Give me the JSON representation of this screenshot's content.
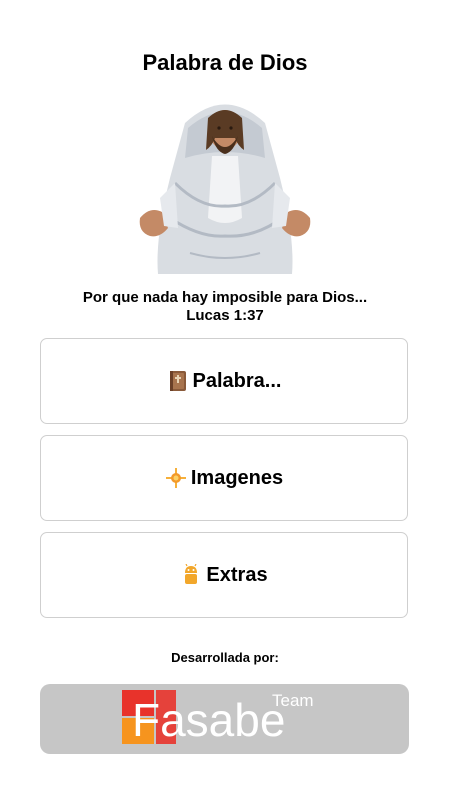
{
  "app": {
    "title": "Palabra de Dios"
  },
  "hero": {
    "image": "jesus-figure"
  },
  "verse": {
    "text": "Por que nada hay imposible para Dios...",
    "reference": "Lucas 1:37"
  },
  "menu": {
    "items": [
      {
        "label": "Palabra...",
        "icon": "book-icon"
      },
      {
        "label": "Imagenes",
        "icon": "sparkle-icon"
      },
      {
        "label": "Extras",
        "icon": "android-icon"
      }
    ]
  },
  "footer": {
    "credit": "Desarrollada por:",
    "logo_text": "Fasabe",
    "logo_sub": "Team"
  },
  "colors": {
    "logo_red": "#e8332b",
    "logo_orange": "#f6941e",
    "button_border": "#cfcfcf",
    "footer_bg": "#c6c6c6"
  }
}
